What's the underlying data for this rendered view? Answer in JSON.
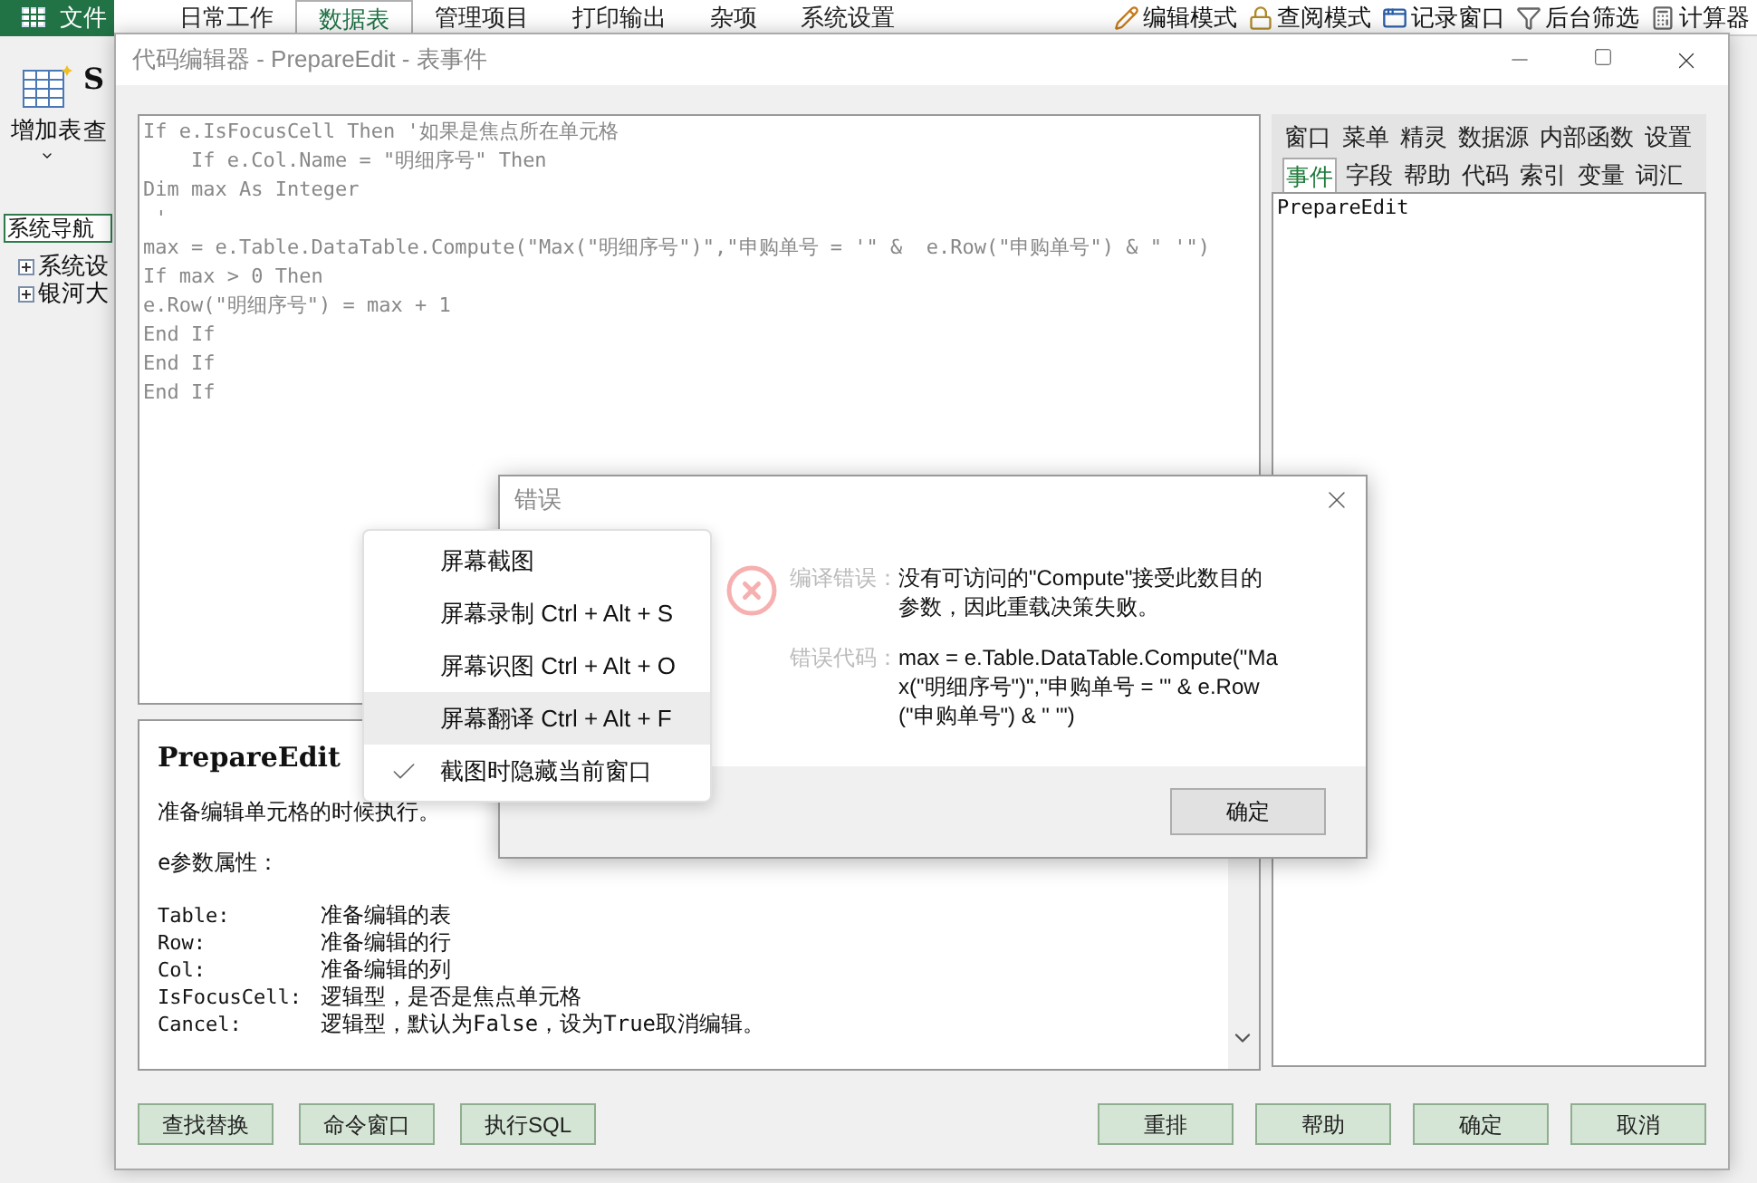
{
  "app": {
    "file_button": "文件",
    "tabs": [
      {
        "label": "日常工作",
        "selected": false
      },
      {
        "label": "数据表",
        "selected": true
      },
      {
        "label": "管理项目",
        "selected": false
      },
      {
        "label": "打印输出",
        "selected": false
      },
      {
        "label": "杂项",
        "selected": false
      },
      {
        "label": "系统设置",
        "selected": false
      }
    ],
    "tools": [
      {
        "kind": "pencil",
        "label": "编辑模式"
      },
      {
        "kind": "lock",
        "label": "查阅模式"
      },
      {
        "kind": "window",
        "label": "记录窗口"
      },
      {
        "kind": "filter",
        "label": "后台筛选"
      },
      {
        "kind": "calc",
        "label": "计算器"
      }
    ],
    "ribbon": {
      "add_table": "增加表",
      "query": "查",
      "title": "S"
    },
    "nav": {
      "label": "系统导航",
      "items": [
        "系统设",
        "银河大"
      ]
    }
  },
  "editor": {
    "title": "代码编辑器 - PrepareEdit - 表事件",
    "code_lines": [
      "If e.IsFocusCell Then '如果是焦点所在单元格",
      "    If e.Col.Name = \"明细序号\" Then",
      "Dim max As Integer",
      " '",
      "max = e.Table.DataTable.Compute(\"Max(\"明细序号\")\",\"申购单号 = '\" &  e.Row(\"申购单号\") & \" '\")",
      "If max > 0 Then",
      "e.Row(\"明细序号\") = max + 1",
      "End If",
      "End If",
      "End If"
    ],
    "help": {
      "title": "PrepareEdit",
      "description": "准备编辑单元格的时候执行。",
      "section": "e参数属性：",
      "properties": [
        {
          "name": "Table:",
          "text": "准备编辑的表"
        },
        {
          "name": "Row:",
          "text": "准备编辑的行"
        },
        {
          "name": "Col:",
          "text": "准备编辑的列"
        },
        {
          "name": "IsFocusCell:",
          "text": "逻辑型，是否是焦点单元格"
        },
        {
          "name": "Cancel:",
          "text": "逻辑型，默认为False，设为True取消编辑。"
        }
      ]
    },
    "panel_tabs": [
      [
        {
          "label": "窗口",
          "selected": false
        },
        {
          "label": "菜单",
          "selected": false
        },
        {
          "label": "精灵",
          "selected": false
        },
        {
          "label": "数据源",
          "selected": false
        },
        {
          "label": "内部函数",
          "selected": false
        },
        {
          "label": "设置",
          "selected": false
        }
      ],
      [
        {
          "label": "事件",
          "selected": true
        },
        {
          "label": "字段",
          "selected": false
        },
        {
          "label": "帮助",
          "selected": false
        },
        {
          "label": "代码",
          "selected": false
        },
        {
          "label": "索引",
          "selected": false
        },
        {
          "label": "变量",
          "selected": false
        },
        {
          "label": "词汇",
          "selected": false
        }
      ]
    ],
    "panel_items": [
      "PrepareEdit"
    ],
    "left_buttons": [
      "查找替换",
      "命令窗口",
      "执行SQL"
    ],
    "right_buttons": [
      "重排",
      "帮助",
      "确定",
      "取消"
    ]
  },
  "error_dialog": {
    "title": "错误",
    "message_label": "编译错误：",
    "message": "没有可访问的\"Compute\"接受此数目的参数，因此重载决策失败。",
    "code_label": "错误代码：",
    "code": "max = e.Table.DataTable.Compute(\"Max(\"明细序号\")\",\"申购单号 = '\" &  e.Row(\"申购单号\") & \" '\")",
    "ok": "确定"
  },
  "context_menu": [
    {
      "label": "屏幕截图",
      "checked": false,
      "selected": false
    },
    {
      "label": "屏幕录制 Ctrl + Alt + S",
      "checked": false,
      "selected": false
    },
    {
      "label": "屏幕识图 Ctrl + Alt + O",
      "checked": false,
      "selected": false
    },
    {
      "label": "屏幕翻译 Ctrl + Alt + F",
      "checked": false,
      "selected": true
    },
    {
      "label": "截图时隐藏当前窗口",
      "checked": true,
      "selected": false
    }
  ]
}
